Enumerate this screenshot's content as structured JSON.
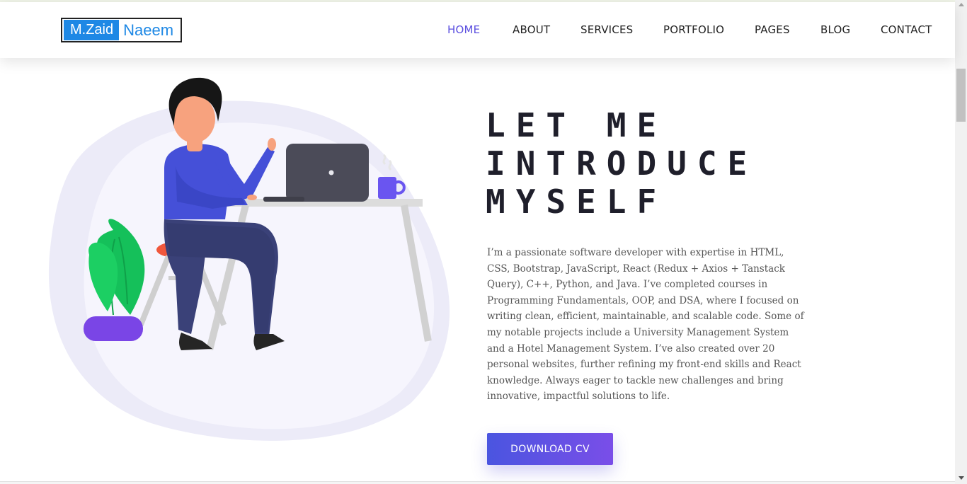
{
  "logo": {
    "first": "M.Zaid",
    "last": "Naeem"
  },
  "nav": {
    "items": [
      {
        "label": "HOME",
        "active": true
      },
      {
        "label": "ABOUT"
      },
      {
        "label": "SERVICES"
      },
      {
        "label": "PORTFOLIO"
      },
      {
        "label": "PAGES"
      },
      {
        "label": "BLOG"
      },
      {
        "label": "CONTACT"
      }
    ]
  },
  "hero": {
    "title_lines": [
      "LET ME",
      "INTRODUCE",
      "MYSELF"
    ],
    "description": "I’m a passionate software developer with expertise in HTML, CSS, Bootstrap, JavaScript, React (Redux + Axios + Tanstack Query), C++, Python, and Java. I’ve completed courses in Programming Fundamentals, OOP, and DSA, where I focused on writing clean, efficient, maintainable, and scalable code. Some of my notable projects include a University Management System and a Hotel Management System. I’ve also created over 20 personal websites, further refining my front-end skills and React knowledge. Always eager to tackle new challenges and bring innovative, impactful solutions to life.",
    "cta_label": "DOWNLOAD CV"
  },
  "illustration": {
    "icon": "developer-at-desk-illustration"
  },
  "colors": {
    "accent": "#5b4fe0",
    "logo_blue": "#1e88e5",
    "button_start": "#4a55e0",
    "button_end": "#7a4ee8",
    "shirt": "#4550d8",
    "pants": "#3a4178",
    "plant": "#15c05a",
    "pot": "#7a45e6",
    "laptop": "#4b4b58",
    "mug": "#6a55f0"
  }
}
